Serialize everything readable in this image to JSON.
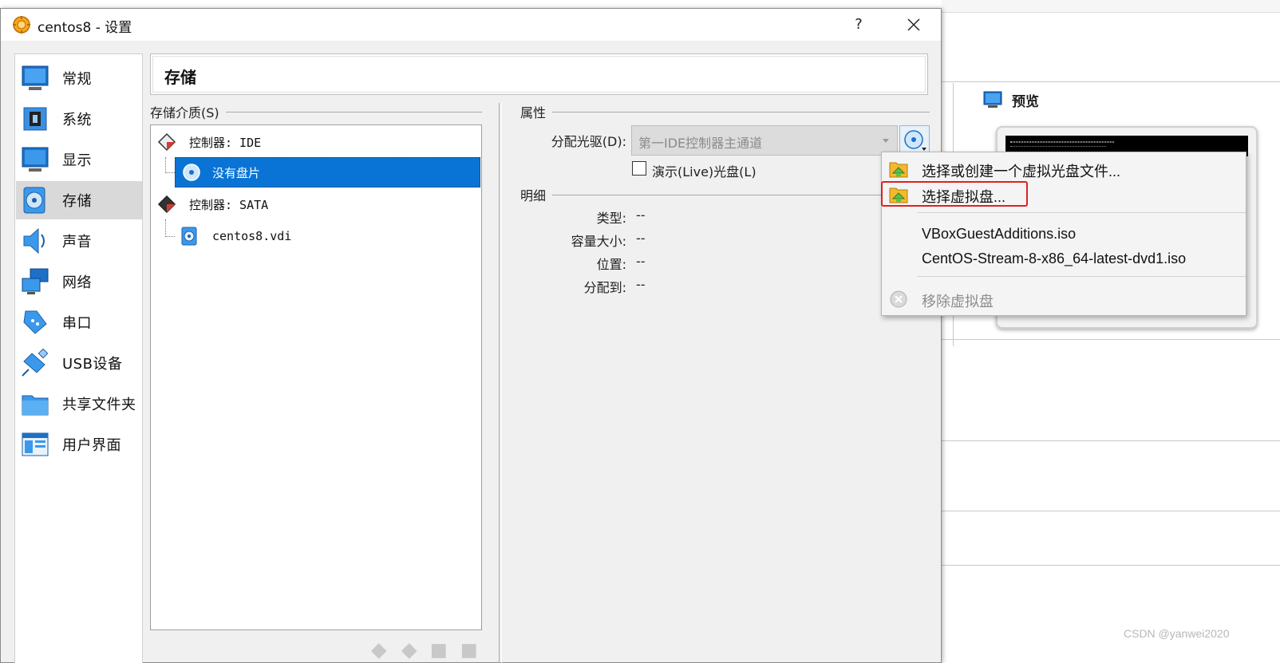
{
  "window": {
    "title": "centos8 - 设置",
    "help_label": "?"
  },
  "nav": {
    "items": [
      {
        "label": "常规",
        "icon": "general-monitor-icon"
      },
      {
        "label": "系统",
        "icon": "system-chip-icon"
      },
      {
        "label": "显示",
        "icon": "display-monitor-icon"
      },
      {
        "label": "存储",
        "icon": "storage-disk-icon",
        "selected": true
      },
      {
        "label": "声音",
        "icon": "audio-speaker-icon"
      },
      {
        "label": "网络",
        "icon": "network-icon"
      },
      {
        "label": "串口",
        "icon": "serial-port-icon"
      },
      {
        "label": "USB设备",
        "icon": "usb-icon"
      },
      {
        "label": "共享文件夹",
        "icon": "shared-folder-icon"
      },
      {
        "label": "用户界面",
        "icon": "user-interface-icon"
      }
    ]
  },
  "page": {
    "title": "存储"
  },
  "storage": {
    "group_label": "存储介质(S)",
    "tree": [
      {
        "label": "控制器: IDE",
        "type": "controller"
      },
      {
        "label": "没有盘片",
        "type": "optical",
        "selected": true
      },
      {
        "label": "控制器: SATA",
        "type": "controller"
      },
      {
        "label": "centos8.vdi",
        "type": "harddisk"
      }
    ]
  },
  "attributes": {
    "group_label": "属性",
    "drive_label": "分配光驱(D):",
    "drive_value": "第一IDE控制器主通道",
    "live_cd_label": "演示(Live)光盘(L)",
    "live_cd_checked": false
  },
  "details": {
    "group_label": "明细",
    "rows": [
      {
        "label": "类型:",
        "value": "--"
      },
      {
        "label": "容量大小:",
        "value": "--"
      },
      {
        "label": "位置:",
        "value": "--"
      },
      {
        "label": "分配到:",
        "value": "--"
      }
    ]
  },
  "menu": {
    "items": [
      {
        "label": "选择或创建一个虚拟光盘文件...",
        "icon": "folder-disk-icon"
      },
      {
        "label": "选择虚拟盘...",
        "icon": "folder-disk-icon",
        "highlighted": true
      },
      {
        "label": "VBoxGuestAdditions.iso"
      },
      {
        "label": "CentOS-Stream-8-x86_64-latest-dvd1.iso"
      },
      {
        "label": "移除虚拟盘",
        "icon": "remove-disk-icon",
        "disabled": true
      }
    ]
  },
  "background": {
    "preview_title": "预览"
  },
  "watermark": "CSDN @yanwei2020",
  "colors": {
    "selection": "#0a74d6",
    "highlight_box": "#e02020",
    "dialog_bg": "#f0f0f0"
  }
}
